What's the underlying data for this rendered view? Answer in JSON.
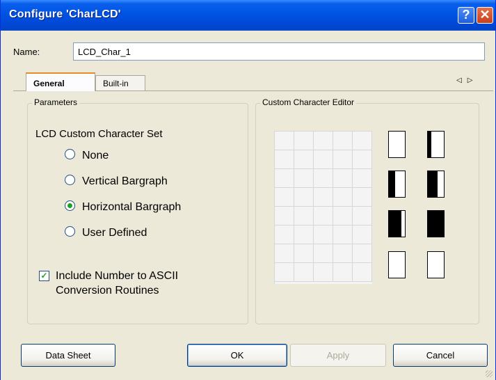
{
  "window": {
    "title": "Configure 'CharLCD'",
    "help_glyph": "?",
    "close_glyph": "✕"
  },
  "name": {
    "label": "Name:",
    "value": "LCD_Char_1"
  },
  "tabs": [
    {
      "label": "General",
      "active": true
    },
    {
      "label": "Built-in",
      "active": false
    }
  ],
  "tab_scroll": {
    "left": "◁",
    "right": "▷"
  },
  "parameters": {
    "legend": "Parameters",
    "heading": "LCD Custom Character Set",
    "options": [
      {
        "label": "None",
        "selected": false
      },
      {
        "label": "Vertical Bargraph",
        "selected": false
      },
      {
        "label": "Horizontal Bargraph",
        "selected": true
      },
      {
        "label": "User Defined",
        "selected": false
      }
    ],
    "checkbox": {
      "line1": "Include Number to ASCII",
      "line2": "Conversion Routines",
      "checked": true
    }
  },
  "editor": {
    "legend": "Custom Character Editor",
    "grid_cols": 5,
    "grid_rows": 8,
    "characters_fill_columns": [
      0,
      1,
      2,
      3,
      4,
      5,
      0,
      0
    ]
  },
  "buttons": {
    "datasheet": "Data Sheet",
    "ok": "OK",
    "apply": "Apply",
    "cancel": "Cancel"
  },
  "colors": {
    "titlebar": "#0055E5",
    "dialog_bg": "#ECE9D8",
    "radio_dot": "#21A121",
    "active_tab_accent": "#E68B2C"
  }
}
